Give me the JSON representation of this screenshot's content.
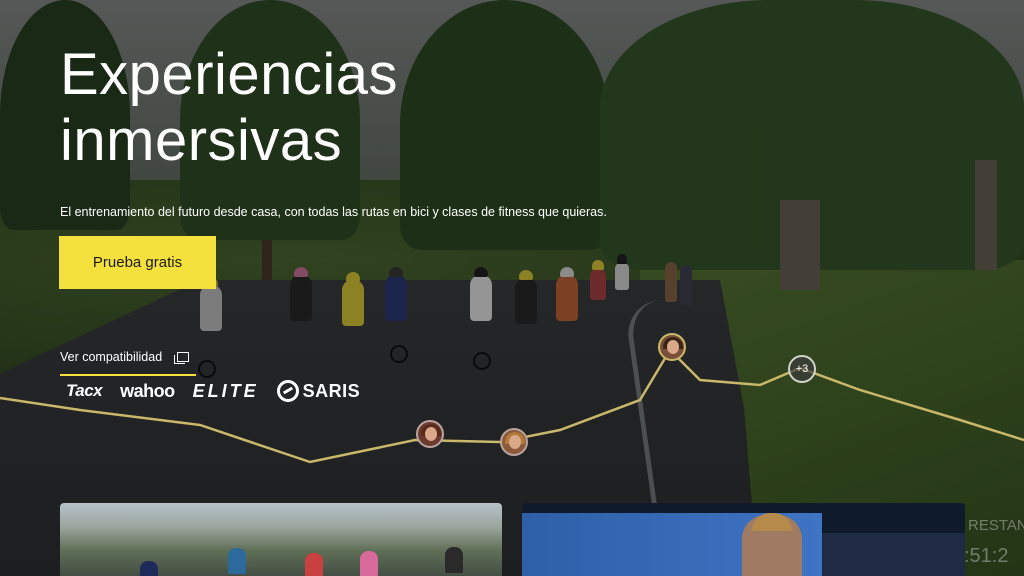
{
  "hero": {
    "title_line1": "Experiencias",
    "title_line2": "inmersivas",
    "subtitle": "El entrenamiento del futuro desde casa, con todas las rutas en bici y clases de fitness que quieras.",
    "cta_label": "Prueba gratis",
    "compat_link": "Ver compatibilidad"
  },
  "brands": {
    "tacx": "Tacx",
    "wahoo": "wahoo",
    "elite": "ELITE",
    "saris": "SARIS"
  },
  "route": {
    "extra_riders_badge": "+3"
  },
  "background_overlay_text": {
    "right_edge_top": "RESTAN",
    "right_edge_bottom": ":51:2"
  },
  "colors": {
    "accent_yellow": "#f5e13e",
    "route_line": "#c9b76a"
  },
  "icons": {
    "compat": "external-window-icon",
    "saris": "saris-logo-icon"
  }
}
